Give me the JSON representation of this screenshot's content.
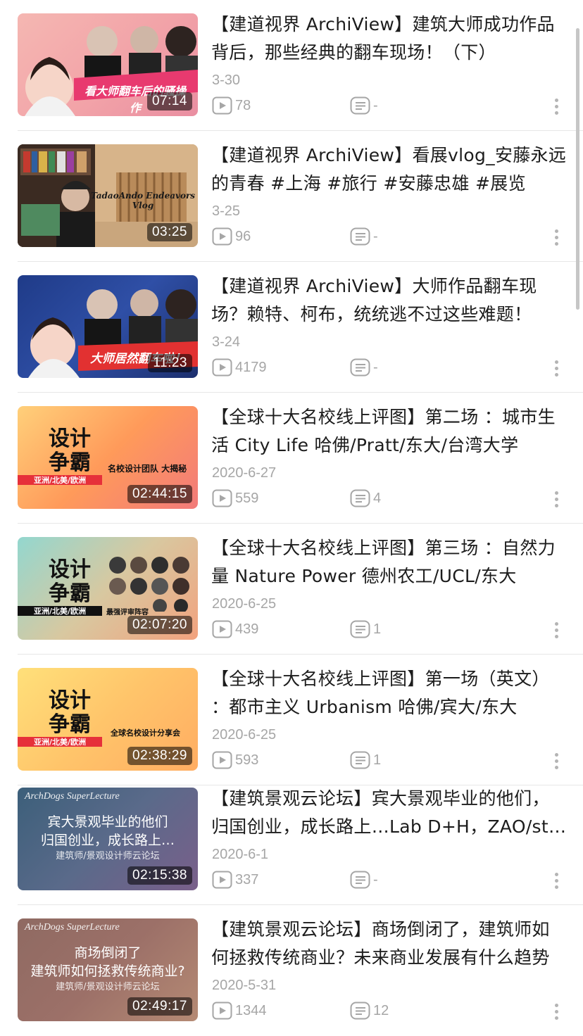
{
  "videos": [
    {
      "title": "【建道视界 ArchiView】建筑大师成功作品背后，那些经典的翻车现场！（下）",
      "date": "3-30",
      "plays": "78",
      "comments": "-",
      "duration": "07:14",
      "thumb_text": "看大师翻车后的骚操作"
    },
    {
      "title": "【建道视界 ArchiView】看展vlog_安藤永远的青春 #上海 #旅行 #安藤忠雄 #展览",
      "date": "3-25",
      "plays": "96",
      "comments": "-",
      "duration": "03:25",
      "thumb_text": "TadaoAndo Endeavors Vlog"
    },
    {
      "title": "【建道视界 ArchiView】大师作品翻车现场？赖特、柯布，统统逃不过这些难题！",
      "date": "3-24",
      "plays": "4179",
      "comments": "-",
      "duration": "11:23",
      "thumb_text": "大师居然翻车啦！"
    },
    {
      "title": "【全球十大名校线上评图】第二场 ：城市生活 City Life 哈佛/Pratt/东大/台湾大学",
      "date": "2020-6-27",
      "plays": "559",
      "comments": "4",
      "duration": "02:44:15",
      "thumb_title": "设计争霸",
      "thumb_band": "亚洲/北美/欧洲",
      "thumb_text": "名校设计团队 大揭秘"
    },
    {
      "title": "【全球十大名校线上评图】第三场 ：自然力量 Nature Power 德州农工/UCL/东大",
      "date": "2020-6-25",
      "plays": "439",
      "comments": "1",
      "duration": "02:07:20",
      "thumb_title": "设计争霸",
      "thumb_band": "亚洲/北美/欧洲",
      "thumb_text": "最强评审阵容"
    },
    {
      "title": "【全球十大名校线上评图】第一场（英文） ：都市主义 Urbanism 哈佛/宾大/东大",
      "date": "2020-6-25",
      "plays": "593",
      "comments": "1",
      "duration": "02:38:29",
      "thumb_title": "设计争霸",
      "thumb_band": "亚洲/北美/欧洲",
      "thumb_text": "全球名校设计分享会"
    },
    {
      "title": "【建筑景观云论坛】宾大景观毕业的他们，归国创业，成长路上…Lab D+H，ZAO/standardarchitecture",
      "date": "2020-6-1",
      "plays": "337",
      "comments": "-",
      "duration": "02:15:38",
      "thumb_brand": "ArchDogs SuperLecture",
      "thumb_line1": "宾大景观毕业的他们",
      "thumb_line2": "归国创业，成长路上…",
      "thumb_sub": "建筑师/景观设计师云论坛"
    },
    {
      "title": "【建筑景观云论坛】商场倒闭了，建筑师如何拯救传统商业？未来商业发展有什么趋势",
      "date": "2020-5-31",
      "plays": "1344",
      "comments": "12",
      "duration": "02:49:17",
      "thumb_brand": "ArchDogs SuperLecture",
      "thumb_line1": "商场倒闭了",
      "thumb_line2": "建筑师如何拯救传统商业?",
      "thumb_sub": "建筑师/景观设计师云论坛"
    }
  ]
}
